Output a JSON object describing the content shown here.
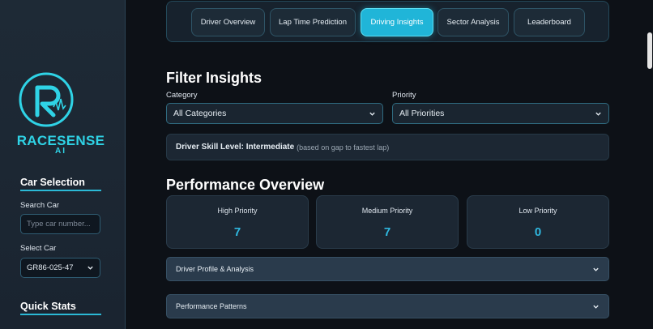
{
  "sidebar": {
    "brand_main": "RACESENSE",
    "brand_sub": "AI",
    "car_selection_heading": "Car Selection",
    "search_label": "Search Car",
    "search_placeholder": "Type car number...",
    "select_label": "Select Car",
    "selected_car": "GR86-025-47",
    "quick_stats_heading": "Quick Stats"
  },
  "tabs": [
    {
      "label": "Driver Overview",
      "active": false
    },
    {
      "label": "Lap Time Prediction",
      "active": false
    },
    {
      "label": "Driving Insights",
      "active": true
    },
    {
      "label": "Sector Analysis",
      "active": false
    },
    {
      "label": "Leaderboard",
      "active": false
    }
  ],
  "filter": {
    "heading": "Filter Insights",
    "category_label": "Category",
    "category_value": "All Categories",
    "priority_label": "Priority",
    "priority_value": "All Priorities"
  },
  "skill": {
    "label": "Driver Skill Level: Intermediate",
    "note": "(based on gap to fastest lap)"
  },
  "overview": {
    "heading": "Performance Overview",
    "cards": [
      {
        "label": "High Priority",
        "value": "7"
      },
      {
        "label": "Medium Priority",
        "value": "7"
      },
      {
        "label": "Low Priority",
        "value": "0"
      }
    ]
  },
  "sections": [
    {
      "label": "Driver Profile & Analysis"
    },
    {
      "label": "Performance Patterns"
    }
  ],
  "colors": {
    "accent": "#20b5d8",
    "background": "#0d1117",
    "sidebar": "#1e2a36",
    "value": "#2fb8e0"
  }
}
